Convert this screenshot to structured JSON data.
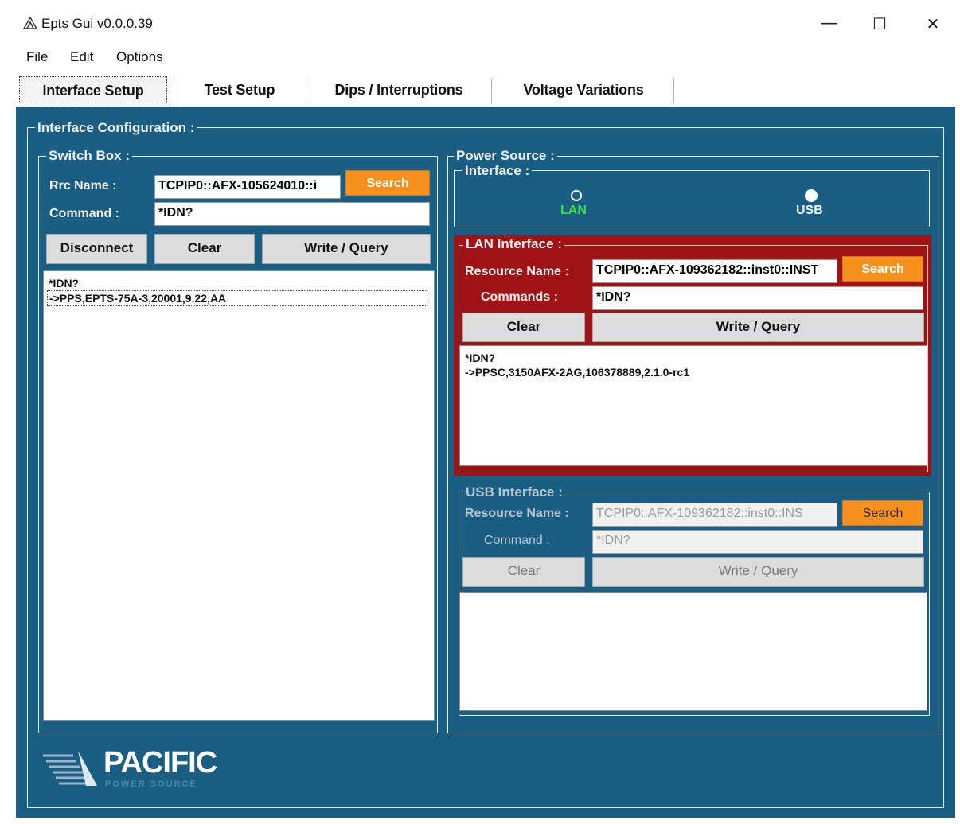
{
  "window": {
    "title": "Epts Gui v0.0.0.39",
    "minimize": "—",
    "maximize": "☐",
    "close": "✕"
  },
  "menu": [
    "File",
    "Edit",
    "Options"
  ],
  "tabs": [
    "Interface Setup",
    "Test Setup",
    "Dips / Interruptions",
    "Voltage Variations"
  ],
  "interface_config": {
    "title": "Interface Configuration :"
  },
  "switch_box": {
    "title": "Switch Box :",
    "rrc_label": "Rrc Name :",
    "rrc_value": "TCPIP0::AFX-105624010::i",
    "search_label": "Search",
    "command_label": "Command :",
    "command_value": "*IDN?",
    "disconnect_label": "Disconnect",
    "clear_label": "Clear",
    "write_label": "Write / Query",
    "output_line1": "*IDN?",
    "output_line2": "->PPS,EPTS-75A-3,20001,9.22,AA"
  },
  "power_source": {
    "title": "Power Source :",
    "interface_title": "Interface :",
    "lan_label": "LAN",
    "usb_label": "USB",
    "lan_interface": {
      "title": "LAN Interface :",
      "resource_label": "Resource Name :",
      "resource_value": "TCPIP0::AFX-109362182::inst0::INST",
      "search_label": "Search",
      "commands_label": "Commands :",
      "commands_value": "*IDN?",
      "clear_label": "Clear",
      "write_label": "Write / Query",
      "output_line1": "*IDN?",
      "output_line2": "->PPSC,3150AFX-2AG,106378889,2.1.0-rc1"
    },
    "usb_interface": {
      "title": "USB Interface :",
      "resource_label": "Resource Name :",
      "resource_value": "TCPIP0::AFX-109362182::inst0::INS",
      "search_label": "Search",
      "command_label": "Command :",
      "command_value": "*IDN?",
      "clear_label": "Clear",
      "write_label": "Write / Query"
    }
  },
  "logo": {
    "name": "PACIFIC",
    "tagline": "POWER SOURCE"
  },
  "colors": {
    "panel": "#1a5e84",
    "accent": "#f7911e",
    "lan_panel": "#a01214",
    "lan_text": "#3ee03e"
  }
}
